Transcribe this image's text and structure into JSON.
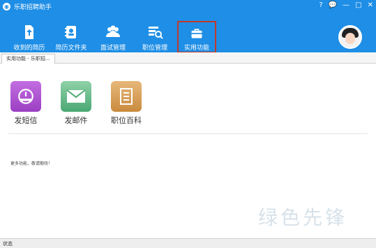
{
  "window": {
    "title": "乐职招聘助手",
    "controls": [
      "?",
      "💬",
      "—",
      "□",
      "✕"
    ]
  },
  "toolbar": {
    "items": [
      {
        "label": "收到的简历",
        "icon": "resume-upload-icon"
      },
      {
        "label": "简历文件夹",
        "icon": "contacts-folder-icon"
      },
      {
        "label": "面试管理",
        "icon": "group-people-icon"
      },
      {
        "label": "职位管理",
        "icon": "job-search-icon"
      },
      {
        "label": "实用功能",
        "icon": "briefcase-icon"
      }
    ]
  },
  "tab": {
    "label": "实用功能 - 乐职招..."
  },
  "features": [
    {
      "label": "发短信",
      "icon": "sms-icon",
      "color": "#b552d6"
    },
    {
      "label": "发邮件",
      "icon": "mail-icon",
      "color": "#6bbf8e"
    },
    {
      "label": "职位百科",
      "icon": "encyclopedia-icon",
      "color": "#d9a15b"
    }
  ],
  "more_text": "更多功能，敬请期待！",
  "watermark": "绿色先锋",
  "status": "状态"
}
